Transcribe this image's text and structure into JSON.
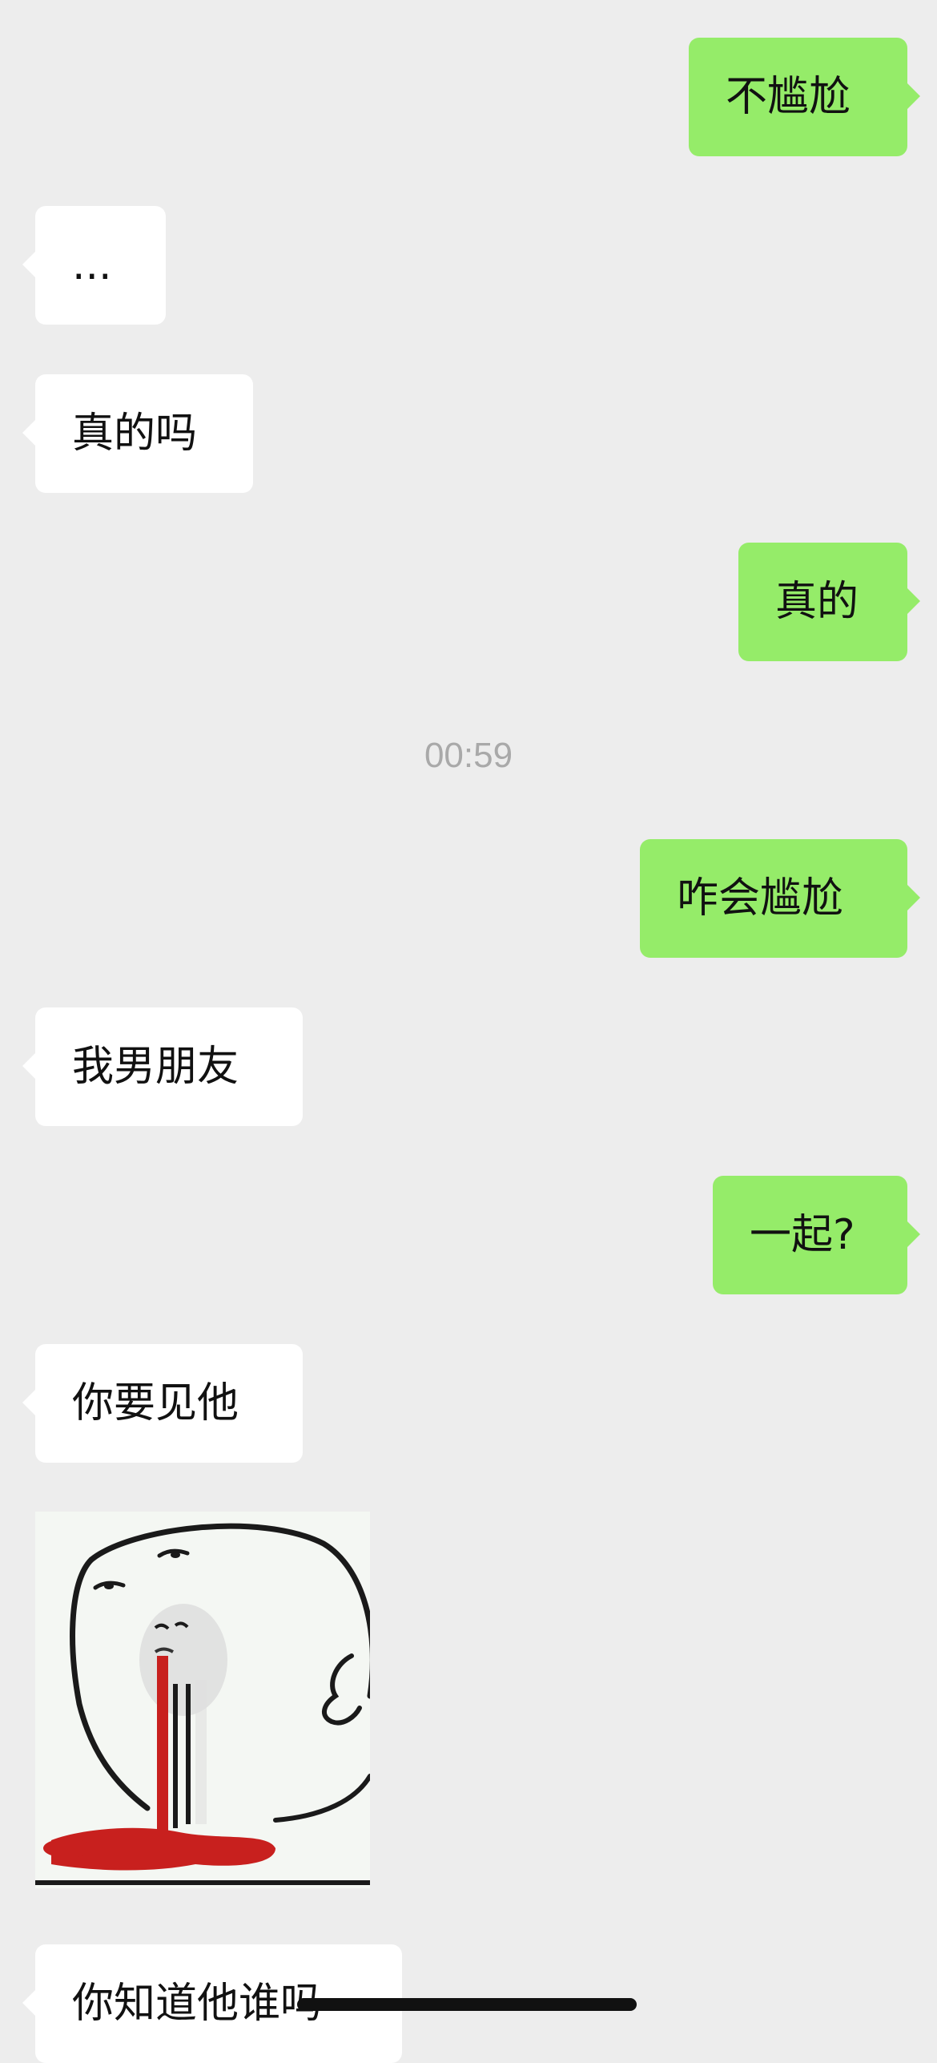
{
  "messages": [
    {
      "id": "m1",
      "direction": "outgoing",
      "text": "不尴尬"
    },
    {
      "id": "m2",
      "direction": "incoming",
      "text": "..."
    },
    {
      "id": "m3",
      "direction": "incoming",
      "text": "真的吗"
    },
    {
      "id": "m4",
      "direction": "outgoing",
      "text": "真的"
    },
    {
      "id": "m5",
      "direction": "outgoing",
      "text": "咋会尴尬"
    },
    {
      "id": "m6",
      "direction": "incoming",
      "text": "我男朋友"
    },
    {
      "id": "m7",
      "direction": "outgoing",
      "text": "一起?"
    },
    {
      "id": "m8",
      "direction": "incoming",
      "text": "你要见他"
    },
    {
      "id": "m9",
      "direction": "incoming",
      "type": "sticker",
      "icon": "nosebleed-meme-sticker"
    },
    {
      "id": "m10",
      "direction": "incoming",
      "text": "你知道他谁吗"
    }
  ],
  "timestamp": "00:59",
  "colors": {
    "background": "#EDEDED",
    "outgoing_bubble": "#95EC69",
    "incoming_bubble": "#FFFFFF",
    "timestamp_text": "#A9A9A9"
  }
}
